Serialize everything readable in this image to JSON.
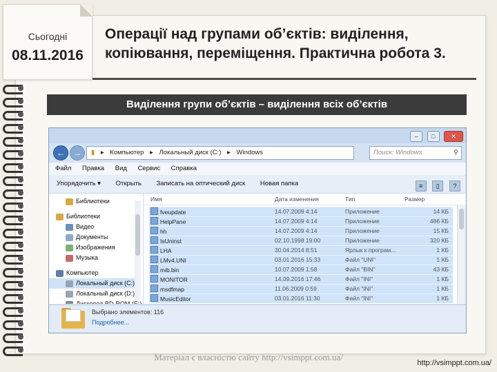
{
  "slide": {
    "date_label": "Сьогодні",
    "date_value": "08.11.2016",
    "title": "Операції над групами об’єктів: виділення, копіювання, переміщення. Практична робота 3.",
    "subtitle": "Виділення групи об’єктів – виділення всіх об’єктів",
    "watermark": "Матеріал є власністю сайту http://vsimppt.com.ua/",
    "url": "http://vsimppt.com.ua/"
  },
  "explorer": {
    "window_buttons": {
      "minimize": "–",
      "maximize": "□",
      "close": "✕"
    },
    "address": {
      "back_icon": "←",
      "forward_icon": "→",
      "path": [
        "Компьютер",
        "Локальный диск (C:)",
        "Windows"
      ],
      "separator": "▸"
    },
    "search_placeholder": "Поиск: Windows",
    "menu": [
      "Файл",
      "Правка",
      "Вид",
      "Сервис",
      "Справка"
    ],
    "toolbar": [
      "Упорядочить ▾",
      "Открыть",
      "Записать на оптический диск",
      "Новая папка"
    ],
    "nav_items": [
      {
        "label": "Библиотеки",
        "icon": "library-icon",
        "indent": 1,
        "selected": false
      },
      {
        "label": "Библиотеки",
        "icon": "library-icon",
        "indent": 0,
        "selected": false
      },
      {
        "label": "Видео",
        "icon": "video-icon",
        "indent": 1,
        "selected": false
      },
      {
        "label": "Документы",
        "icon": "documents-icon",
        "indent": 1,
        "selected": false
      },
      {
        "label": "Изображения",
        "icon": "images-icon",
        "indent": 1,
        "selected": false
      },
      {
        "label": "Музыка",
        "icon": "music-icon",
        "indent": 1,
        "selected": false
      },
      {
        "label": "Компьютер",
        "icon": "computer-icon",
        "indent": 0,
        "selected": false
      },
      {
        "label": "Локальный диск (C:)",
        "icon": "disk-icon",
        "indent": 1,
        "selected": true
      },
      {
        "label": "Локальный диск (D:)",
        "icon": "disk-icon",
        "indent": 1,
        "selected": false
      },
      {
        "label": "Дисковод BD-ROM (E:)",
        "icon": "disc-drive-icon",
        "indent": 1,
        "selected": false
      }
    ],
    "columns": [
      "Имя",
      "Дата изменения",
      "Тип",
      "Размер"
    ],
    "files": [
      {
        "name": "fveupdate",
        "date": "14.07.2009 4:14",
        "type": "Приложение",
        "size": "14 КБ"
      },
      {
        "name": "HelpPane",
        "date": "14.07.2009 4:14",
        "type": "Приложение",
        "size": "486 КБ"
      },
      {
        "name": "hh",
        "date": "14.07.2009 4:14",
        "type": "Приложение",
        "size": "15 КБ"
      },
      {
        "name": "IsUninst",
        "date": "02.10.1998 19:00",
        "type": "Приложение",
        "size": "320 КБ"
      },
      {
        "name": "LHA",
        "date": "30.04.2014 8:51",
        "type": "Ярлык к програм...",
        "size": "1 КБ"
      },
      {
        "name": "LMv4.UNI",
        "date": "03.01.2016 15:33",
        "type": "Файл \"UNI\"",
        "size": "1 КБ"
      },
      {
        "name": "mib.bin",
        "date": "10.07.2009 1:58",
        "type": "Файл \"BIN\"",
        "size": "43 КБ"
      },
      {
        "name": "MONITOR",
        "date": "14.09.2016 17:46",
        "type": "Файл \"INI\"",
        "size": "1 КБ"
      },
      {
        "name": "msdfmap",
        "date": "11.06.2009 0:59",
        "type": "Файл \"INI\"",
        "size": "1 КБ"
      },
      {
        "name": "MusicEditor",
        "date": "03.01.2016 11:30",
        "type": "Файл \"INI\"",
        "size": "1 КБ"
      }
    ],
    "status": {
      "selected": "Выбрано элементов: 116",
      "more": "Подробнее..."
    }
  }
}
